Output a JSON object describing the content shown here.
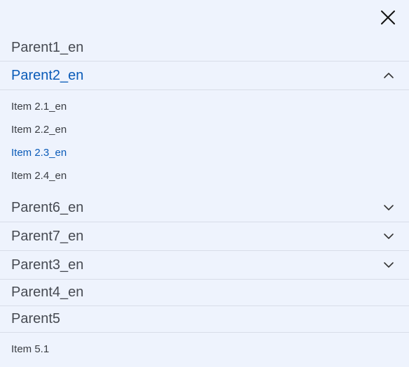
{
  "menu": {
    "close_icon": "close-icon",
    "parents": [
      {
        "label": "Parent1_en",
        "expandable": false
      },
      {
        "label": "Parent2_en",
        "expandable": true,
        "expanded": true,
        "active": true,
        "children": [
          "Item 2.1_en",
          "Item 2.2_en",
          "Item 2.3_en",
          "Item 2.4_en"
        ],
        "active_child": "Item 2.3_en"
      },
      {
        "label": "Parent6_en",
        "expandable": true,
        "expanded": false
      },
      {
        "label": "Parent7_en",
        "expandable": true,
        "expanded": false
      },
      {
        "label": "Parent3_en",
        "expandable": true,
        "expanded": false
      },
      {
        "label": "Parent4_en",
        "expandable": false
      },
      {
        "label": "Parent5",
        "expandable": false,
        "expanded": true,
        "children": [
          "Item 5.1"
        ]
      }
    ]
  },
  "colors": {
    "background": "#eef3fd",
    "active": "#0a5bb8",
    "text": "#464a52",
    "divider": "#d8dde8"
  }
}
